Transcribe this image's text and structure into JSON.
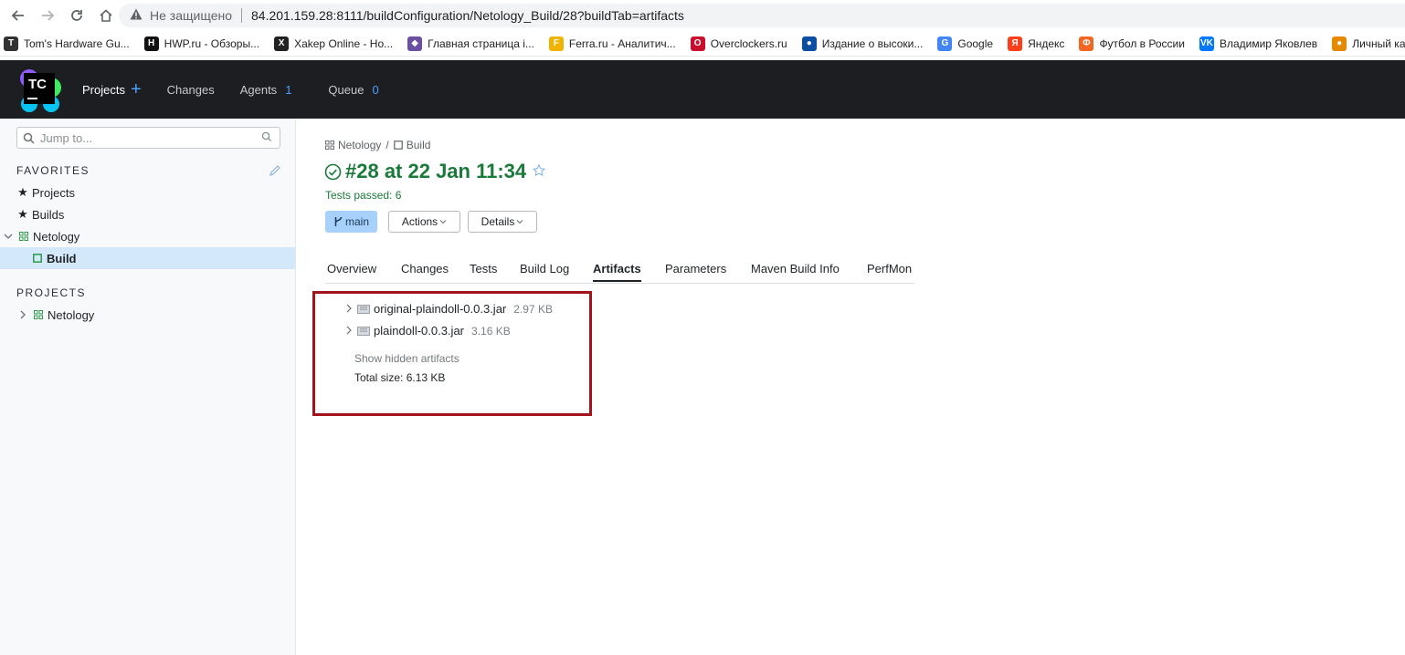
{
  "browser": {
    "insecure_label": "Не защищено",
    "url": "84.201.159.28:8111/buildConfiguration/Netology_Build/28?buildTab=artifacts"
  },
  "bookmarks": [
    {
      "label": "Tom's Hardware Gu...",
      "color": "#333333",
      "glyph": "T"
    },
    {
      "label": "HWP.ru - Обзоры...",
      "color": "#111111",
      "glyph": "H"
    },
    {
      "label": "Xakep Online - Но...",
      "color": "#222222",
      "glyph": "X"
    },
    {
      "label": "Главная страница i...",
      "color": "#6b4fa0",
      "glyph": "◆"
    },
    {
      "label": "Ferra.ru - Аналитич...",
      "color": "#f0b400",
      "glyph": "F"
    },
    {
      "label": "Overclockers.ru",
      "color": "#c8102e",
      "glyph": "O"
    },
    {
      "label": "Издание о высоки...",
      "color": "#0b4ea2",
      "glyph": "●"
    },
    {
      "label": "Google",
      "color": "#4285f4",
      "glyph": "G"
    },
    {
      "label": "Яндекс",
      "color": "#fc3f1d",
      "glyph": "Я"
    },
    {
      "label": "Футбол в России",
      "color": "#f26522",
      "glyph": "Ф"
    },
    {
      "label": "Владимир Яковлев",
      "color": "#0077ff",
      "glyph": "VK"
    },
    {
      "label": "Личный ка",
      "color": "#e58a00",
      "glyph": "●"
    }
  ],
  "header": {
    "logo_text": "TC",
    "projects": "Projects",
    "changes": "Changes",
    "agents": "Agents",
    "agents_count": "1",
    "queue": "Queue",
    "queue_count": "0"
  },
  "sidebar": {
    "search_placeholder": "Jump to...",
    "favorites_title": "FAVORITES",
    "favorites": [
      "Projects",
      "Builds"
    ],
    "tree_project": "Netology",
    "tree_build": "Build",
    "projects_title": "PROJECTS",
    "projects_item": "Netology"
  },
  "main": {
    "breadcrumb_project": "Netology",
    "breadcrumb_sep": "/",
    "breadcrumb_build": "Build",
    "title": "#28 at 22 Jan 11:34",
    "tests": "Tests passed: 6",
    "branch": "main",
    "actions": "Actions",
    "details": "Details",
    "tabs": [
      "Overview",
      "Changes",
      "Tests",
      "Build Log",
      "Artifacts",
      "Parameters",
      "Maven Build Info",
      "PerfMon"
    ],
    "active_tab": "Artifacts",
    "artifacts": [
      {
        "name": "original-plaindoll-0.0.3.jar",
        "size": "2.97 KB"
      },
      {
        "name": "plaindoll-0.0.3.jar",
        "size": "3.16 KB"
      }
    ],
    "show_hidden": "Show hidden artifacts",
    "total_size": "Total size: 6.13 KB"
  },
  "colors": {
    "success": "#1a7a3a",
    "accent": "#4aa0ff",
    "highlight_border": "#a2131c"
  }
}
